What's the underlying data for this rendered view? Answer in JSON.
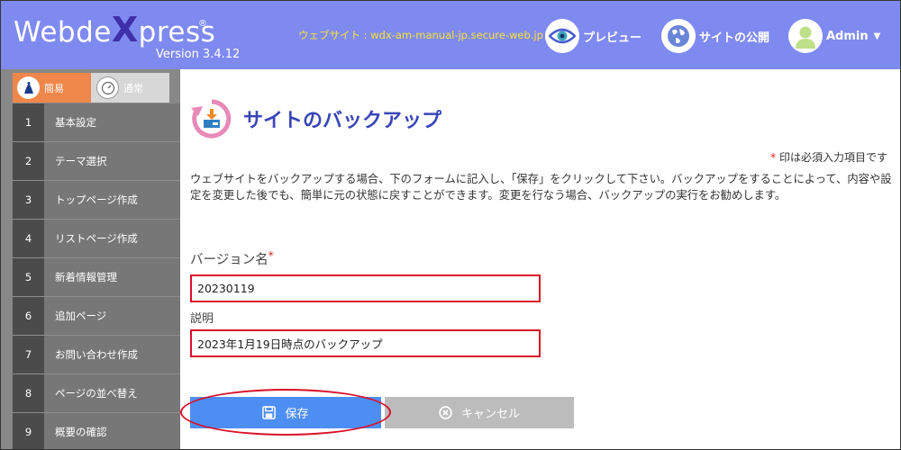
{
  "app": {
    "logo_text_1": "Webde",
    "logo_text_x": "X",
    "logo_text_2": "press",
    "logo_reg": "®",
    "version": "Version 3.4.12",
    "site_url": "ウェブサイト : wdx-am-manual-jp.secure-web.jp"
  },
  "header": {
    "preview_label": "プレビュー",
    "publish_label": "サイトの公開",
    "admin_label": "Admin"
  },
  "sidebar": {
    "mode_easy": "簡易",
    "mode_normal": "通常",
    "items": [
      {
        "num": "1",
        "label": "基本設定"
      },
      {
        "num": "2",
        "label": "テーマ選択"
      },
      {
        "num": "3",
        "label": "トップページ作成"
      },
      {
        "num": "4",
        "label": "リストページ作成"
      },
      {
        "num": "5",
        "label": "新着情報管理"
      },
      {
        "num": "6",
        "label": "追加ページ"
      },
      {
        "num": "7",
        "label": "お問い合わせ作成"
      },
      {
        "num": "8",
        "label": "ページの並べ替え"
      },
      {
        "num": "9",
        "label": "概要の確認"
      }
    ]
  },
  "main": {
    "title": "サイトのバックアップ",
    "required_star": "*",
    "required_note": " 印は必須入力項目です",
    "description": "ウェブサイトをバックアップする場合、下のフォームに記入し、「保存」をクリックして下さい。バックアップをすることによって、内容や設定を変更した後でも、簡単に元の状態に戻すことができます。変更を行なう場合、バックアップの実行をお勧めします。",
    "version_label": "バージョン名",
    "version_star": "*",
    "version_value": "20230119",
    "desc_label": "説明",
    "desc_value": "2023年1月19日時点のバックアップ",
    "save_label": "保存",
    "cancel_label": "キャンセル"
  },
  "colors": {
    "header_bg": "#7f8af0",
    "accent": "#3a46b8",
    "url_text": "#f5e23a",
    "easy_mode": "#f0874a",
    "save_button": "#4d8ef2",
    "error_border": "#d9102a"
  }
}
